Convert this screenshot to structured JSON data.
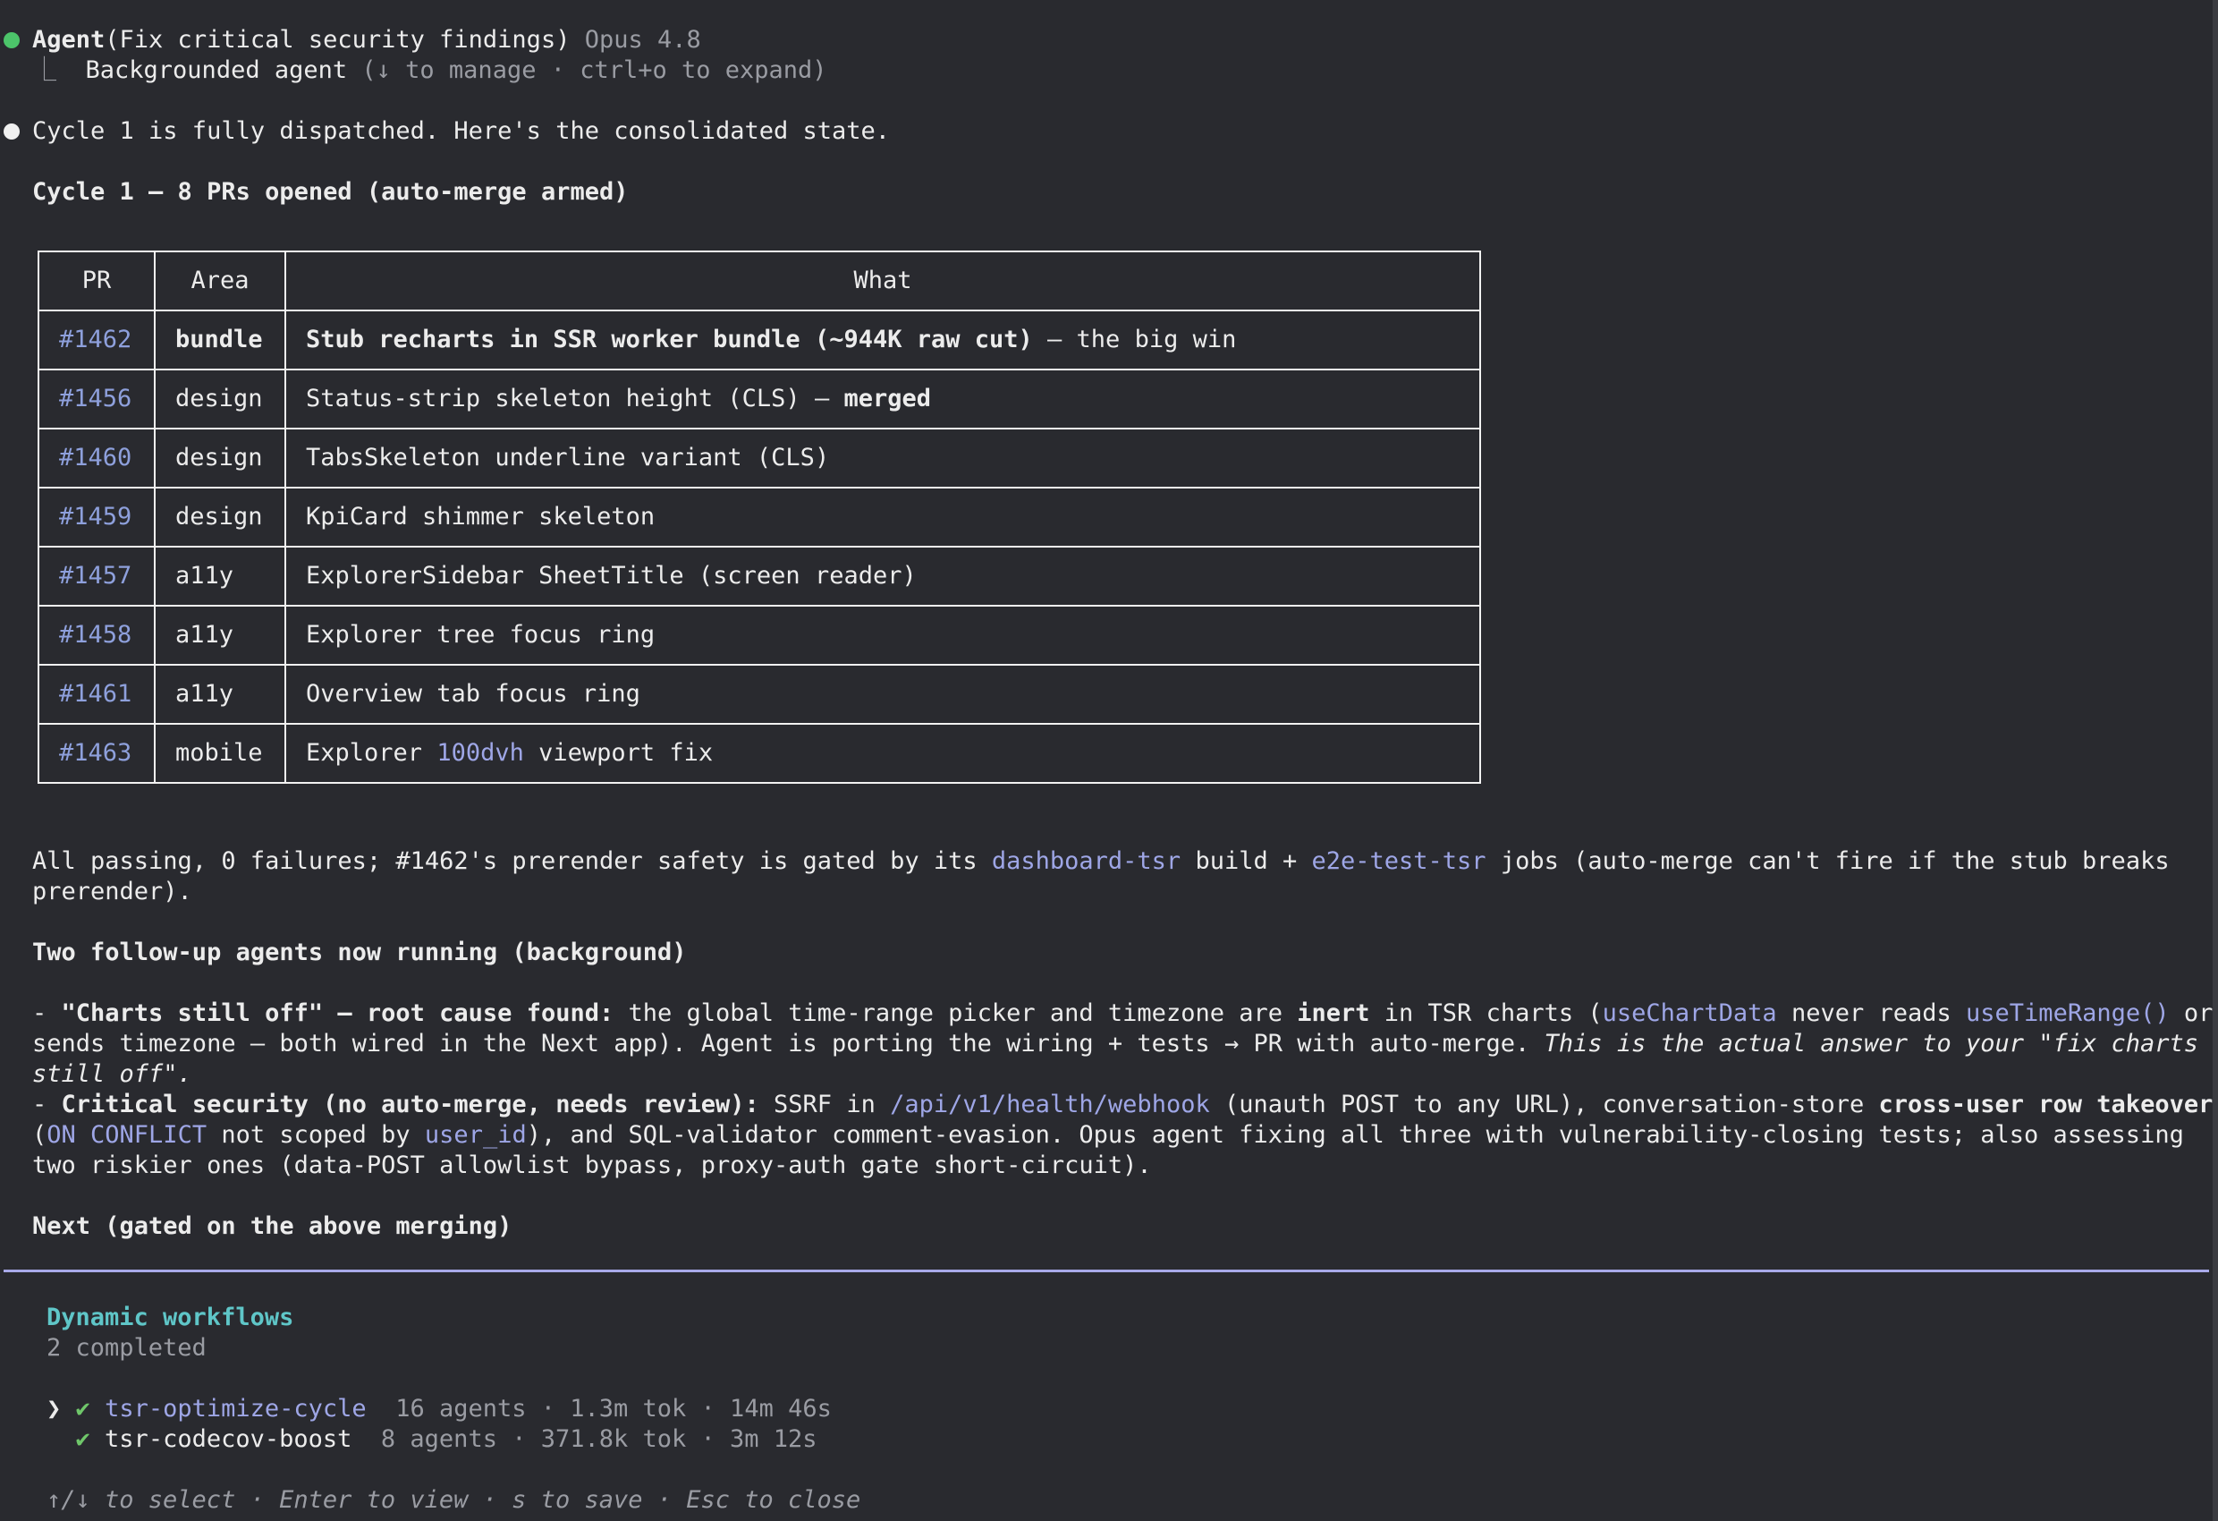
{
  "header": {
    "agent_label": "Agent",
    "agent_task": "(Fix critical security findings)",
    "model": "Opus 4.8",
    "tree_glyph": "⎿",
    "background_label": "Backgrounded agent",
    "background_hint": "(↓ to manage · ctrl+o to expand)",
    "status_color": "#4cc46a"
  },
  "message": {
    "intro": "Cycle 1 is fully dispatched. Here's the consolidated state.",
    "section_title": "Cycle 1 — 8 PRs opened (auto-merge armed)"
  },
  "table": {
    "headers": [
      "PR",
      "Area",
      "What"
    ],
    "rows": [
      {
        "pr": "#1462",
        "area": "bundle",
        "what_bold": "Stub recharts in SSR worker bundle (~944K raw cut)",
        "what_rest": " — the big win"
      },
      {
        "pr": "#1456",
        "area": "design",
        "what_pre": "Status-strip skeleton height (CLS) — ",
        "what_bold": "merged"
      },
      {
        "pr": "#1460",
        "area": "design",
        "what": "TabsSkeleton underline variant (CLS)"
      },
      {
        "pr": "#1459",
        "area": "design",
        "what": "KpiCard shimmer skeleton"
      },
      {
        "pr": "#1457",
        "area": "a11y",
        "what": "ExplorerSidebar SheetTitle (screen reader)"
      },
      {
        "pr": "#1458",
        "area": "a11y",
        "what": "Explorer tree focus ring"
      },
      {
        "pr": "#1461",
        "area": "a11y",
        "what": "Overview tab focus ring"
      },
      {
        "pr": "#1463",
        "area": "mobile",
        "what_pre": "Explorer ",
        "what_code": "100dvh",
        "what_post": " viewport fix"
      }
    ]
  },
  "status_para": {
    "t1": "All passing, 0 failures; #1462's prerender safety is gated by its ",
    "c1": "dashboard-tsr",
    "t2": " build + ",
    "c2": "e2e-test-tsr",
    "t3": " jobs (auto-merge can't fire if the stub breaks prerender)."
  },
  "followup": {
    "title": "Two follow-up agents now running (background)",
    "item1": {
      "dash": "- ",
      "bold": "\"Charts still off\" — root cause found:",
      "t1": " the global time-range picker and timezone are ",
      "b2": "inert",
      "t2": " in TSR charts (",
      "c1": "useChartData",
      "t3": " never reads ",
      "c2": "useTimeRange()",
      "t4": " or sends timezone — both wired in the Next app). Agent is porting the wiring + tests → PR with auto-merge. ",
      "italic": "This is the actual answer to your \"fix charts still off\"."
    },
    "item2": {
      "dash": "- ",
      "bold": "Critical security (no auto-merge, needs review):",
      "t1": " SSRF in ",
      "c1": "/api/v1/health/webhook",
      "t2": " (unauth POST to any URL), conversation-store ",
      "b2": "cross-user row takeover",
      "t3": " (",
      "c2": "ON CONFLICT",
      "t4": " not scoped by ",
      "c3": "user_id",
      "t5": "), and SQL-validator comment-evasion. Opus agent fixing all three with vulnerability-closing tests; also assessing two riskier ones (data-POST allowlist bypass, proxy-auth gate short-circuit)."
    }
  },
  "next_title": "Next (gated on the above merging)",
  "workflows": {
    "title": "Dynamic workflows",
    "summary": "2 completed",
    "selector": "❯",
    "check": "✔",
    "items": [
      {
        "name": "tsr-optimize-cycle",
        "meta": "16 agents · 1.3m tok · 14m 46s"
      },
      {
        "name": "tsr-codecov-boost",
        "meta": "8 agents · 371.8k tok · 3m 12s"
      }
    ],
    "footer_hint": "↑/↓ to select · Enter to view · s to save · Esc to close"
  }
}
